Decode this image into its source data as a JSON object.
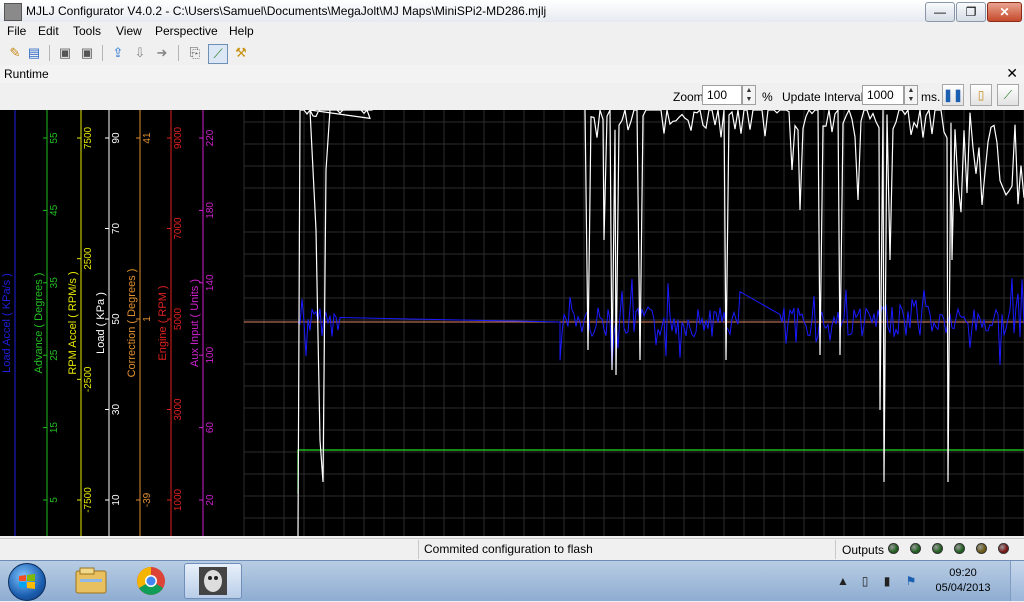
{
  "window": {
    "title": "MJLJ Configurator V4.0.2 - C:\\Users\\Samuel\\Documents\\MegaJolt\\MJ Maps\\MiniSPi2-MD286.mjlj",
    "buttons": {
      "minimize": "—",
      "maximize": "❐",
      "close": "✕"
    }
  },
  "menu": [
    "File",
    "Edit",
    "Tools",
    "View",
    "Perspective",
    "Help"
  ],
  "toolbar": {
    "icons": [
      "new-icon",
      "open-icon",
      "save-icon",
      "save-as-icon",
      "upload-icon",
      "download-icon",
      "flash-icon",
      "export-icon",
      "graph-icon",
      "wrench-icon"
    ]
  },
  "panel": {
    "title": "Runtime",
    "close": "✕"
  },
  "controls": {
    "zoom_label": "Zoom",
    "zoom_value": "100",
    "zoom_unit": "%",
    "interval_label": "Update Interval",
    "interval_value": "1000",
    "interval_unit": "ms."
  },
  "chart_data": {
    "type": "line",
    "background": "#000000",
    "grid": true,
    "axes": [
      {
        "label": "Load Accel ( KPa/s )",
        "color": "#1f1fe0",
        "ticks": []
      },
      {
        "label": "Advance ( Degrees )",
        "color": "#22c022",
        "ticks": [
          "55",
          "45",
          "35",
          "25",
          "15",
          "5"
        ]
      },
      {
        "label": "RPM Accel ( RPM/s )",
        "color": "#e8e800",
        "ticks": [
          "7500",
          "2500",
          "-2500",
          "-7500"
        ]
      },
      {
        "label": "Load ( KPa )",
        "color": "#ffffff",
        "ticks": [
          "90",
          "70",
          "50",
          "30",
          "10"
        ]
      },
      {
        "label": "Correction ( Degrees )",
        "color": "#e09030",
        "ticks": [
          "41",
          "1",
          "-39"
        ]
      },
      {
        "label": "Engine ( RPM )",
        "color": "#e02020",
        "ticks": [
          "9000",
          "7000",
          "5000",
          "3000",
          "1000"
        ]
      },
      {
        "label": "Aux Input ( Units )",
        "color": "#d020d0",
        "ticks": [
          "220",
          "180",
          "140",
          "100",
          "60",
          "20"
        ]
      }
    ],
    "series_colors": {
      "load": "#ffffff",
      "load_accel": "#1a1aff",
      "correction": "#e08060",
      "advance": "#22dd22"
    }
  },
  "status": {
    "message": "Commited configuration to flash",
    "outputs_label": "Outputs",
    "leds": [
      "#1f5f1f",
      "#1f5f1f",
      "#1f5f1f",
      "#1f5f1f",
      "#6b5a10",
      "#7a1414"
    ]
  },
  "taskbar": {
    "apps": [
      "explorer-icon",
      "chrome-icon",
      "mjlj-icon"
    ],
    "time": "09:20",
    "date": "05/04/2013"
  }
}
